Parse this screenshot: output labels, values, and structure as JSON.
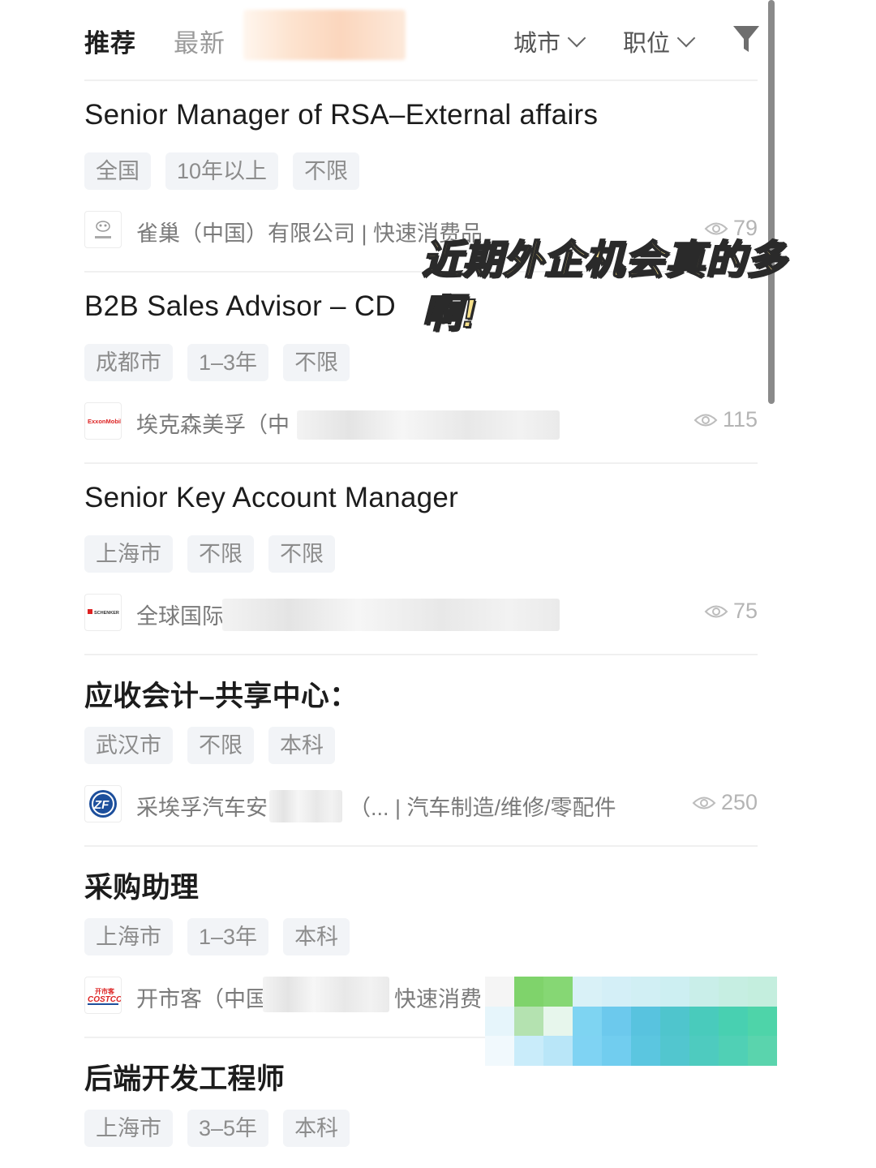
{
  "header": {
    "tabs": [
      {
        "label": "推荐",
        "active": true
      },
      {
        "label": "最新",
        "active": false
      }
    ],
    "filters": {
      "city": "城市",
      "position": "职位"
    },
    "filter_icon": "funnel-icon"
  },
  "caption": {
    "line1": "近期外企机会真的多",
    "line2": "啊!"
  },
  "jobs": [
    {
      "title": "Senior Manager of RSA–External affairs",
      "tags": [
        "全国",
        "10年以上",
        "不限"
      ],
      "company": "雀巢（中国）有限公司 | 快速消费品",
      "views": "79",
      "logo": "nestle-logo"
    },
    {
      "title": "B2B Sales Advisor – CD",
      "tags": [
        "成都市",
        "1–3年",
        "不限"
      ],
      "company": "埃克森美孚（中",
      "views": "115",
      "logo": "exxonmobil-logo"
    },
    {
      "title": "Senior Key Account Manager",
      "tags": [
        "上海市",
        "不限",
        "不限"
      ],
      "company": "全球国际",
      "views": "75",
      "logo": "schenker-logo"
    },
    {
      "title": "应收会计–共享中心：",
      "tags": [
        "武汉市",
        "不限",
        "本科"
      ],
      "company_a": "采埃孚汽车安",
      "company_b": "（... | 汽车制造/维修/零配件",
      "views": "250",
      "logo": "zf-logo"
    },
    {
      "title": "采购助理",
      "tags": [
        "上海市",
        "1–3年",
        "本科"
      ],
      "company_a": "开市客（中国",
      "company_b": "快速消费",
      "logo": "costco-logo"
    },
    {
      "title": "后端开发工程师",
      "tags": [
        "上海市",
        "3–5年",
        "本科"
      ]
    }
  ],
  "logo_text": {
    "exxon": "ExxonMobil",
    "schenker": "SCHENKER",
    "costco_top": "开市客",
    "costco_bottom": "COSTCO"
  },
  "colors": {
    "caption_fill": "#f6e08a",
    "tag_bg": "#f2f4f7",
    "mosaic_green": "#8fd67a",
    "mosaic_teal": "#4fcfc0",
    "mosaic_blue": "#7ad3f2"
  }
}
